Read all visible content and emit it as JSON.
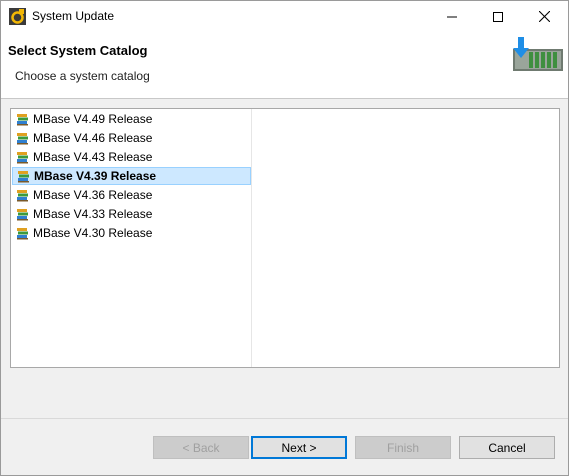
{
  "window": {
    "title": "System Update"
  },
  "header": {
    "title": "Select System Catalog",
    "subtitle": "Choose a system catalog"
  },
  "catalog": {
    "selected": "MBase V4.39 Release",
    "items": [
      {
        "label": "MBase V4.49 Release"
      },
      {
        "label": "MBase V4.46 Release"
      },
      {
        "label": "MBase V4.43 Release"
      },
      {
        "label": "MBase V4.39 Release"
      },
      {
        "label": "MBase V4.36 Release"
      },
      {
        "label": "MBase V4.33 Release"
      },
      {
        "label": "MBase V4.30 Release"
      }
    ]
  },
  "buttons": {
    "back": "< Back",
    "next": "Next >",
    "finish": "Finish",
    "cancel": "Cancel"
  }
}
